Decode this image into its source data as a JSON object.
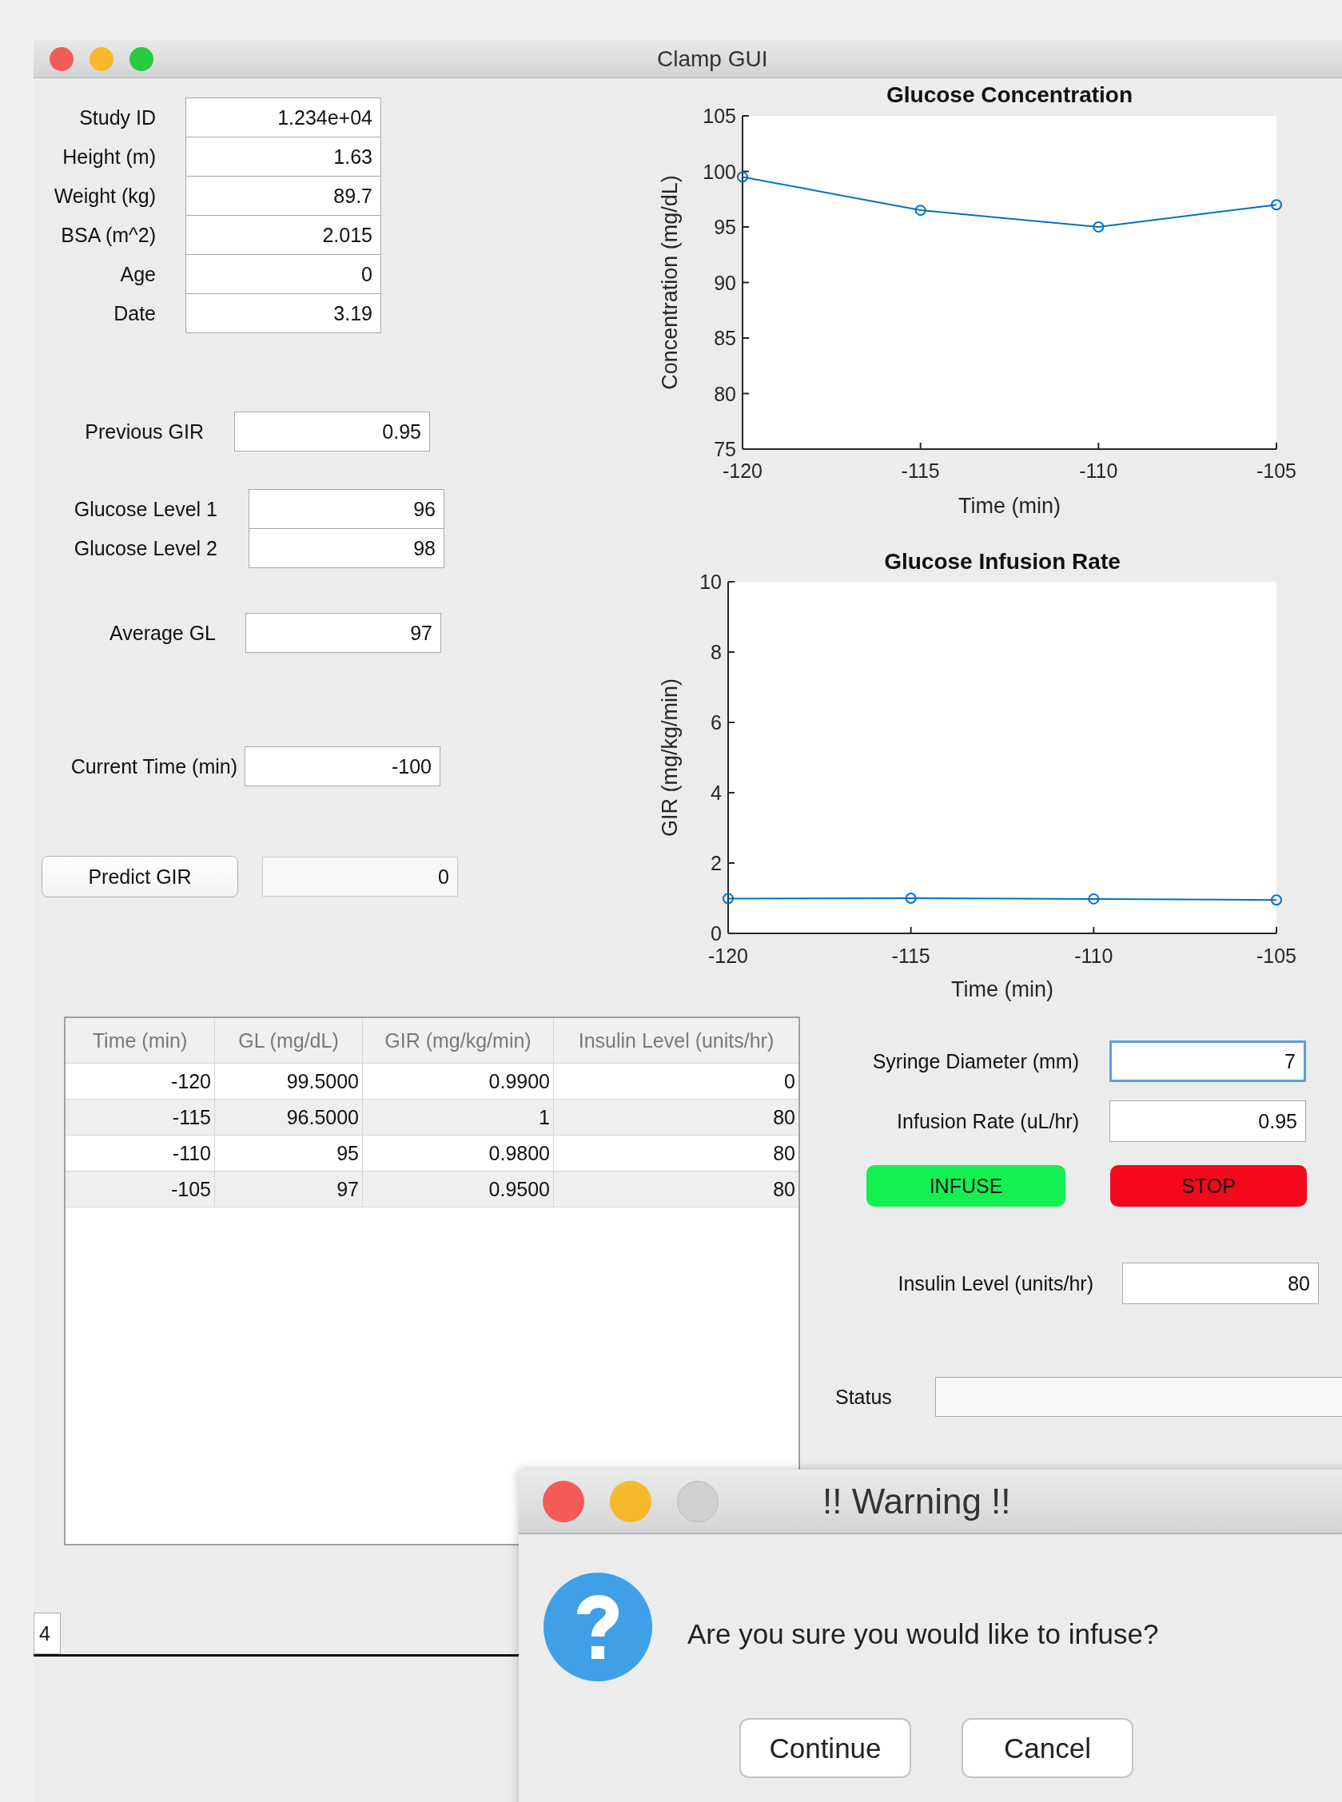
{
  "window": {
    "title": "Clamp GUI"
  },
  "patient_fields": [
    {
      "label": "Study ID",
      "value": "1.234e+04"
    },
    {
      "label": "Height (m)",
      "value": "1.63"
    },
    {
      "label": "Weight (kg)",
      "value": "89.7"
    },
    {
      "label": "BSA (m^2)",
      "value": "2.015"
    },
    {
      "label": "Age",
      "value": "0"
    },
    {
      "label": "Date",
      "value": "3.19"
    }
  ],
  "previous_gir": {
    "label": "Previous GIR",
    "value": "0.95"
  },
  "glucose_levels": [
    {
      "label": "Glucose Level 1",
      "value": "96"
    },
    {
      "label": "Glucose Level 2",
      "value": "98"
    }
  ],
  "average_gl": {
    "label": "Average GL",
    "value": "97"
  },
  "current_time": {
    "label": "Current Time (min)",
    "value": "-100"
  },
  "predict": {
    "button": "Predict GIR",
    "value": "0",
    "disabled": true
  },
  "charts": [
    {
      "chart_data": {
        "type": "line",
        "title": "Glucose Concentration",
        "xlabel": "Time (min)",
        "ylabel": "Concentration (mg/dL)",
        "x": [
          -120,
          -115,
          -110,
          -105
        ],
        "series": [
          {
            "color": "#0072bd",
            "marker": "o",
            "values": [
              99.5,
              96.5,
              95,
              97
            ]
          }
        ],
        "xlim": [
          -120,
          -105
        ],
        "ylim": [
          75,
          105
        ],
        "xticks": [
          -120,
          -115,
          -110,
          -105
        ],
        "yticks": [
          75,
          80,
          85,
          90,
          95,
          100,
          105
        ]
      }
    },
    {
      "chart_data": {
        "type": "line",
        "title": "Glucose Infusion Rate",
        "xlabel": "Time (min)",
        "ylabel": "GIR (mg/kg/min)",
        "x": [
          -120,
          -115,
          -110,
          -105
        ],
        "series": [
          {
            "color": "#0072bd",
            "marker": "o",
            "values": [
              0.99,
              1,
              0.98,
              0.95
            ]
          }
        ],
        "xlim": [
          -120,
          -105
        ],
        "ylim": [
          0,
          10
        ],
        "xticks": [
          -120,
          -115,
          -110,
          -105
        ],
        "yticks": [
          0,
          2,
          4,
          6,
          8,
          10
        ]
      }
    }
  ],
  "table": {
    "columns": [
      "Time (min)",
      "GL (mg/dL)",
      "GIR (mg/kg/min)",
      "Insulin Level (units/hr)"
    ],
    "rows": [
      [
        "-120",
        "99.5000",
        "0.9900",
        "0"
      ],
      [
        "-115",
        "96.5000",
        "1",
        "80"
      ],
      [
        "-110",
        "95",
        "0.9800",
        "80"
      ],
      [
        "-105",
        "97",
        "0.9500",
        "80"
      ]
    ]
  },
  "syringe": {
    "label": "Syringe Diameter (mm)",
    "value": "7",
    "focused": true
  },
  "infusion_rate": {
    "label": "Infusion Rate (uL/hr)",
    "value": "0.95"
  },
  "buttons": [
    {
      "label": "INFUSE",
      "color": "#14f050"
    },
    {
      "label": "STOP",
      "color": "#f5071c"
    }
  ],
  "insulin_level": {
    "label": "Insulin Level (units/hr)",
    "value": "80"
  },
  "status": {
    "label": "Status"
  },
  "page_field": {
    "value": "4"
  },
  "dialog": {
    "title": "!! Warning !!",
    "message": "Are you sure you would like to infuse?",
    "buttons": [
      "Continue",
      "Cancel"
    ]
  }
}
